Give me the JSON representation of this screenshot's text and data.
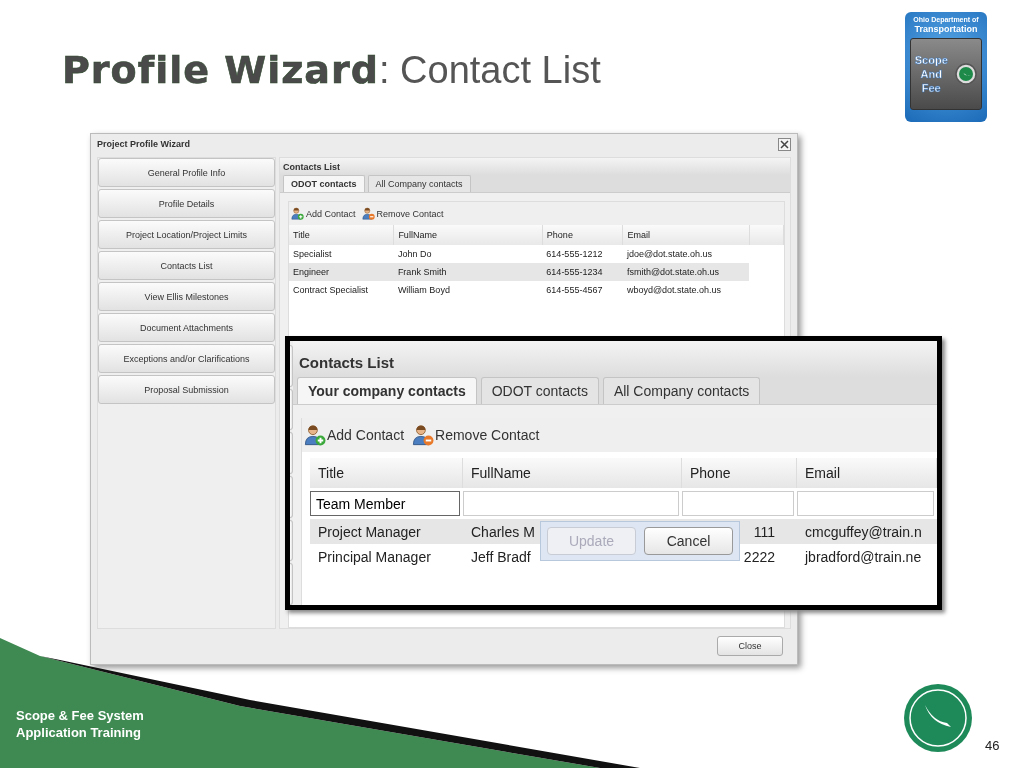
{
  "slide": {
    "title": "**Profile Wizard**: Contact List",
    "footer": [
      "Scope & Fee System",
      "Application Training"
    ],
    "page_number": "46"
  },
  "logo": {
    "agency": [
      "Ohio Department of",
      "Transportation"
    ],
    "words": [
      "Scope",
      "And",
      "Fee"
    ]
  },
  "window": {
    "title": "Project Profile Wizard",
    "nav": [
      "General Profile Info",
      "Profile Details",
      "Project Location/Project Limits",
      "Contacts List",
      "View Ellis Milestones",
      "Document Attachments",
      "Exceptions and/or Clarifications",
      "Proposal Submission"
    ],
    "panel_title": "Contacts List",
    "tabs": [
      {
        "label": "ODOT contacts",
        "selected": true
      },
      {
        "label": "All Company contacts",
        "selected": false
      }
    ],
    "toolbar": [
      {
        "label": "Add Contact",
        "kind": "add"
      },
      {
        "label": "Remove Contact",
        "kind": "remove"
      }
    ],
    "columns": [
      "Title",
      "FullName",
      "Phone",
      "Email"
    ],
    "rows": [
      {
        "cells": [
          "Specialist",
          "John Do",
          "614-555-1212",
          "jdoe@dot.state.oh.us"
        ],
        "selected": false
      },
      {
        "cells": [
          "Engineer",
          "Frank Smith",
          "614-555-1234",
          "fsmith@dot.state.oh.us"
        ],
        "selected": true
      },
      {
        "cells": [
          "Contract Specialist",
          "William Boyd",
          "614-555-4567",
          "wboyd@dot.state.oh.us"
        ],
        "selected": false
      }
    ],
    "close_button": "Close"
  },
  "inset": {
    "panel_title": "Contacts List",
    "tabs": [
      {
        "label": "Your company contacts",
        "selected": true
      },
      {
        "label": "ODOT contacts",
        "selected": false
      },
      {
        "label": "All Company contacts",
        "selected": false
      }
    ],
    "toolbar": [
      {
        "label": "Add Contact",
        "kind": "add"
      },
      {
        "label": "Remove Contact",
        "kind": "remove"
      }
    ],
    "columns": [
      "Title",
      "FullName",
      "Phone",
      "Email"
    ],
    "editor_value": "Team Member",
    "rows": [
      {
        "cells": [
          "Project Manager",
          "Charles M",
          "111",
          "cmcguffey@train.n"
        ],
        "selected": true
      },
      {
        "cells": [
          "Principal Manager",
          "Jeff Bradf",
          "2222",
          "jbradford@train.ne"
        ],
        "selected": false
      }
    ],
    "row_buttons": [
      {
        "label": "Update",
        "disabled": true
      },
      {
        "label": "Cancel",
        "disabled": false
      }
    ]
  }
}
